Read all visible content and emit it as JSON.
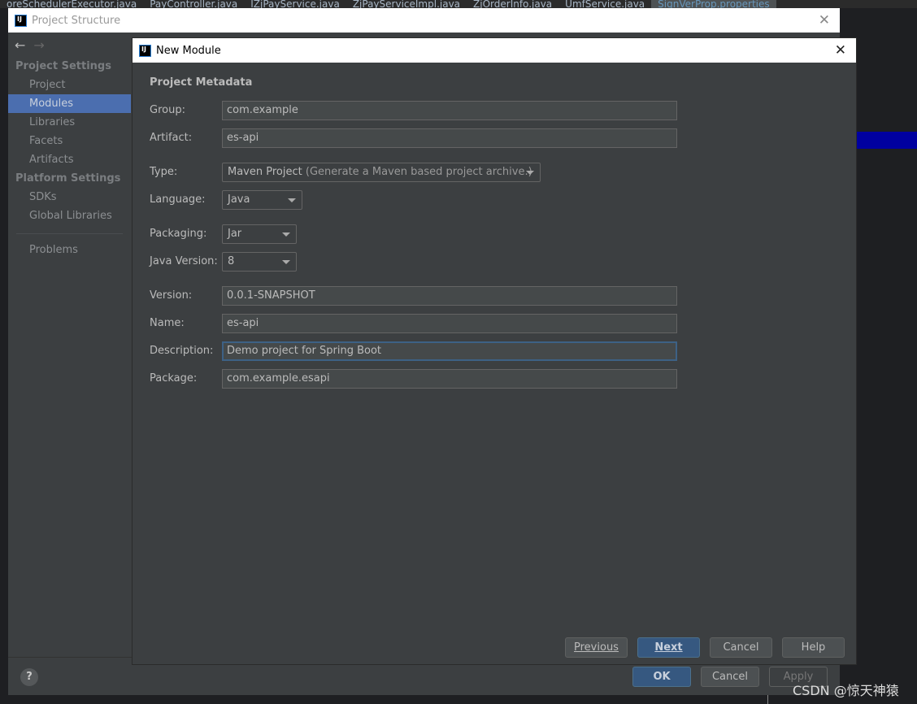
{
  "editor": {
    "tabs": [
      "oreSchedulerExecutor.java",
      "PayController.java",
      "IZjPayService.java",
      "ZjPayServiceImpl.java",
      "ZjOrderInfo.java",
      "UmfService.java",
      "SignVerProp.properties"
    ]
  },
  "project_structure": {
    "title": "Project Structure",
    "sidebar": {
      "project_settings": "Project Settings",
      "items1": [
        "Project",
        "Modules",
        "Libraries",
        "Facets",
        "Artifacts"
      ],
      "platform_settings": "Platform Settings",
      "items2": [
        "SDKs",
        "Global Libraries"
      ],
      "problems": "Problems"
    },
    "selected": "Modules",
    "ok": "OK",
    "cancel": "Cancel",
    "apply": "Apply",
    "help": "?"
  },
  "new_module": {
    "title": "New Module",
    "section": "Project Metadata",
    "fields": {
      "group": {
        "label": "Group:",
        "value": "com.example"
      },
      "artifact": {
        "label": "Artifact:",
        "value": "es-api"
      },
      "type": {
        "label": "Type:",
        "value": "Maven Project",
        "hint": "(Generate a Maven based project archive.)"
      },
      "language": {
        "label": "Language:",
        "value": "Java"
      },
      "packaging": {
        "label": "Packaging:",
        "value": "Jar"
      },
      "java_version": {
        "label": "Java Version:",
        "value": "8"
      },
      "version": {
        "label": "Version:",
        "value": "0.0.1-SNAPSHOT"
      },
      "name": {
        "label": "Name:",
        "value": "es-api"
      },
      "description": {
        "label": "Description:",
        "value": "Demo project for Spring Boot"
      },
      "package": {
        "label": "Package:",
        "value": "com.example.esapi"
      }
    },
    "buttons": {
      "previous": "Previous",
      "next": "Next",
      "cancel": "Cancel",
      "help": "Help"
    }
  },
  "watermark": "CSDN @惊天神猿"
}
